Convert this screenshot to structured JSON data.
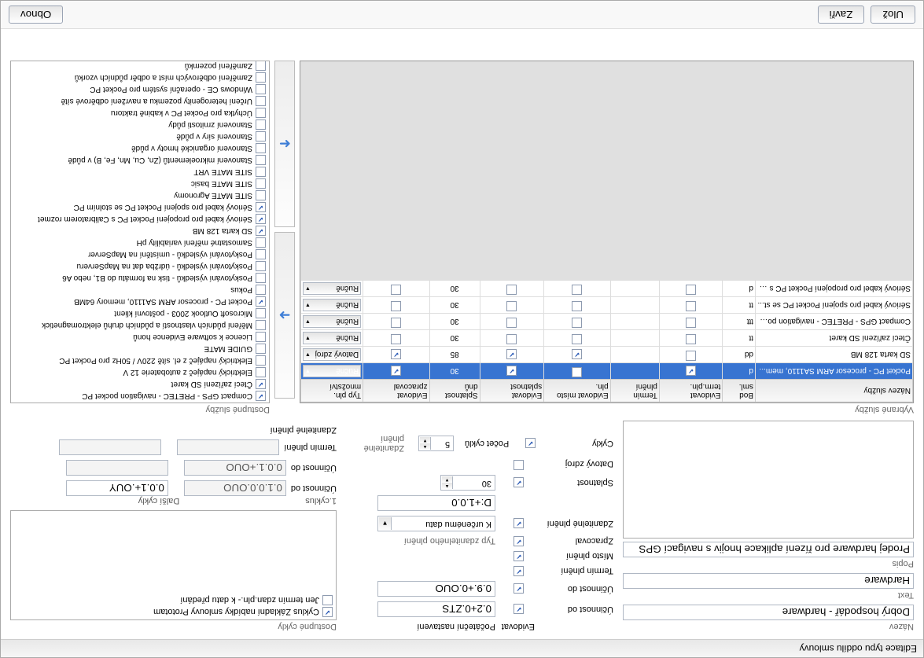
{
  "title": "Editace typu oddílu smlouvy",
  "labels": {
    "nazev": "Název",
    "text": "Text",
    "popis": "Popis",
    "evidovat": "Evidovat",
    "pocNast": "Počáteční nastavení",
    "ucinnostOd": "Účinnost od",
    "ucinnostDo": "Účinnost do",
    "terminPlneni": "Termín plnění",
    "mistoPlneni": "Místo plnění",
    "zpracoval": "Zpracoval",
    "zdanitelnePlneni": "Zdanitelné plnění",
    "typZdan": "Typ zdanitelného plnění",
    "splatnost": "Splatnost",
    "datovyZdroj": "Datový zdroj",
    "cykly": "Cykly",
    "pocetCyklu": "Počet cyklů",
    "dostupneCykly": "Dostupné cykly",
    "cyklusOpt1": "Cyklus Základní nabídky smlouvy Prototam",
    "cyklusOpt2": "Jen termín zdan.pln.- k datu předání",
    "prvniCyklus": "1.cyklus",
    "dalsiCykly": "Další cykly",
    "vybraneSluzby": "Vybrané služby",
    "dostupneSluzby": "Dostupné služby"
  },
  "fields": {
    "nazev": "Dobrý hospodář - hardware",
    "text": "Hardware",
    "popis": "Prodej hardware pro řízení aplikace hnojiv s navigací GPS",
    "ucinnostOd": "0.2+0.ZTS",
    "ucinnostDo": "0.9.+0.OUO",
    "splatnost": "30",
    "dplus": "D:+1.0.0",
    "typZdan": "K určenému datu",
    "pocetCyklu": "5",
    "r_ucinnostOd1": "0.1.0.0.OUO",
    "r_ucinnostOd2": "0.0.1+.OUY",
    "r_ucinnostDo": "0.0.1.+OUO"
  },
  "gridHeaders": [
    "Název služby",
    "Bod sml.",
    "Evidovat term.pln.",
    "Termín plnění",
    "Evidovat místo pln.",
    "Evidovat splatnost",
    "Splatnost dnů",
    "Evidovat zpracoval",
    "Typ pln. množství"
  ],
  "gridRows": [
    {
      "sel": true,
      "name": "Pocket PC - procesor ARM SA1110, mem...",
      "bod": "d",
      "c1": true,
      "c2": false,
      "c3": true,
      "dnu": "30",
      "c4": true,
      "typ": "Ručně"
    },
    {
      "sel": false,
      "name": "SD karta 128 MB",
      "bod": "dd",
      "c1": false,
      "c2": true,
      "c3": true,
      "dnu": "85",
      "c4": true,
      "typ": "Datový zdroj"
    },
    {
      "sel": false,
      "name": "Čtecí zařízení SD karet",
      "bod": "tt",
      "c1": false,
      "c2": false,
      "c3": false,
      "dnu": "30",
      "c4": false,
      "typ": "Ručně"
    },
    {
      "sel": false,
      "name": "Compact GPS - PRETEC - navigation poc...",
      "bod": "ttt",
      "c1": false,
      "c2": false,
      "c3": false,
      "dnu": "30",
      "c4": false,
      "typ": "Ručně"
    },
    {
      "sel": false,
      "name": "Sériový kabel pro spojení Pocket PC se st...",
      "bod": "tt",
      "c1": false,
      "c2": false,
      "c3": false,
      "dnu": "30",
      "c4": false,
      "typ": "Ručně"
    },
    {
      "sel": false,
      "name": "Sériový kabel pro propojení Pocket PC s C...",
      "bod": "d",
      "c1": false,
      "c2": false,
      "c3": false,
      "dnu": "30",
      "c4": false,
      "typ": "Ručně"
    }
  ],
  "services": [
    {
      "chk": true,
      "label": "Compact GPS - PRETEC - navigation pocket PC"
    },
    {
      "chk": true,
      "label": "Čtecí zařízení SD karet"
    },
    {
      "chk": false,
      "label": "Elektrický napáječ z autobaterie 12 V"
    },
    {
      "chk": false,
      "label": "Elektrický napáječ z el. sítě 220V / 50Hz pro Pocket PC"
    },
    {
      "chk": false,
      "label": "GUIDE MATE"
    },
    {
      "chk": false,
      "label": "Licence k software Evidence honů"
    },
    {
      "chk": false,
      "label": "Měření půdních vlastností a půdních druhů elektromagnetick"
    },
    {
      "chk": false,
      "label": "Microsoft Outlook 2003 - poštovní klient"
    },
    {
      "chk": true,
      "label": "Pocket PC - procesor ARM SA1110, memory 64MB"
    },
    {
      "chk": false,
      "label": "Pokus"
    },
    {
      "chk": false,
      "label": "Poskytování výsledků - tisk na formátu do B1, nebo A6"
    },
    {
      "chk": false,
      "label": "Poskytování výsledků - údržba dat na MapServeru"
    },
    {
      "chk": false,
      "label": "Poskytování výsledků - umístění na MapServer"
    },
    {
      "chk": false,
      "label": "Samostatné měření variability pH"
    },
    {
      "chk": true,
      "label": "SD karta 128 MB"
    },
    {
      "chk": true,
      "label": "Sériový kabel pro propojení Pocket PC s Calibratorem rozmet"
    },
    {
      "chk": true,
      "label": "Sériový kabel pro spojení Pocket PC se stolním PC"
    },
    {
      "chk": false,
      "label": "SITE MATE Agronomy"
    },
    {
      "chk": false,
      "label": "SITE MATE basic"
    },
    {
      "chk": false,
      "label": "SITE MATE VRT"
    },
    {
      "chk": false,
      "label": "Stanovení mikroelementů (Zn, Cu, Mn, Fe, B) v půdě"
    },
    {
      "chk": false,
      "label": "Stanovení organické hmoty v půdě"
    },
    {
      "chk": false,
      "label": "Stanovení síry v půdě"
    },
    {
      "chk": false,
      "label": "Stanovení zrnitosti půdy"
    },
    {
      "chk": false,
      "label": "Úchytka pro Pocket PC v kabině traktoru"
    },
    {
      "chk": false,
      "label": "Určení heterogenity pozemku a navržení odběrové sítě"
    },
    {
      "chk": false,
      "label": "Windows CE - operační systém pro Pocket PC"
    },
    {
      "chk": false,
      "label": "Zaměření odběrových míst a odběr půdních vzorků"
    },
    {
      "chk": false,
      "label": "Zaměření pozemků"
    }
  ],
  "buttons": {
    "uloz": "Ulož",
    "zavri": "Zavři",
    "obnov": "Obnov"
  }
}
